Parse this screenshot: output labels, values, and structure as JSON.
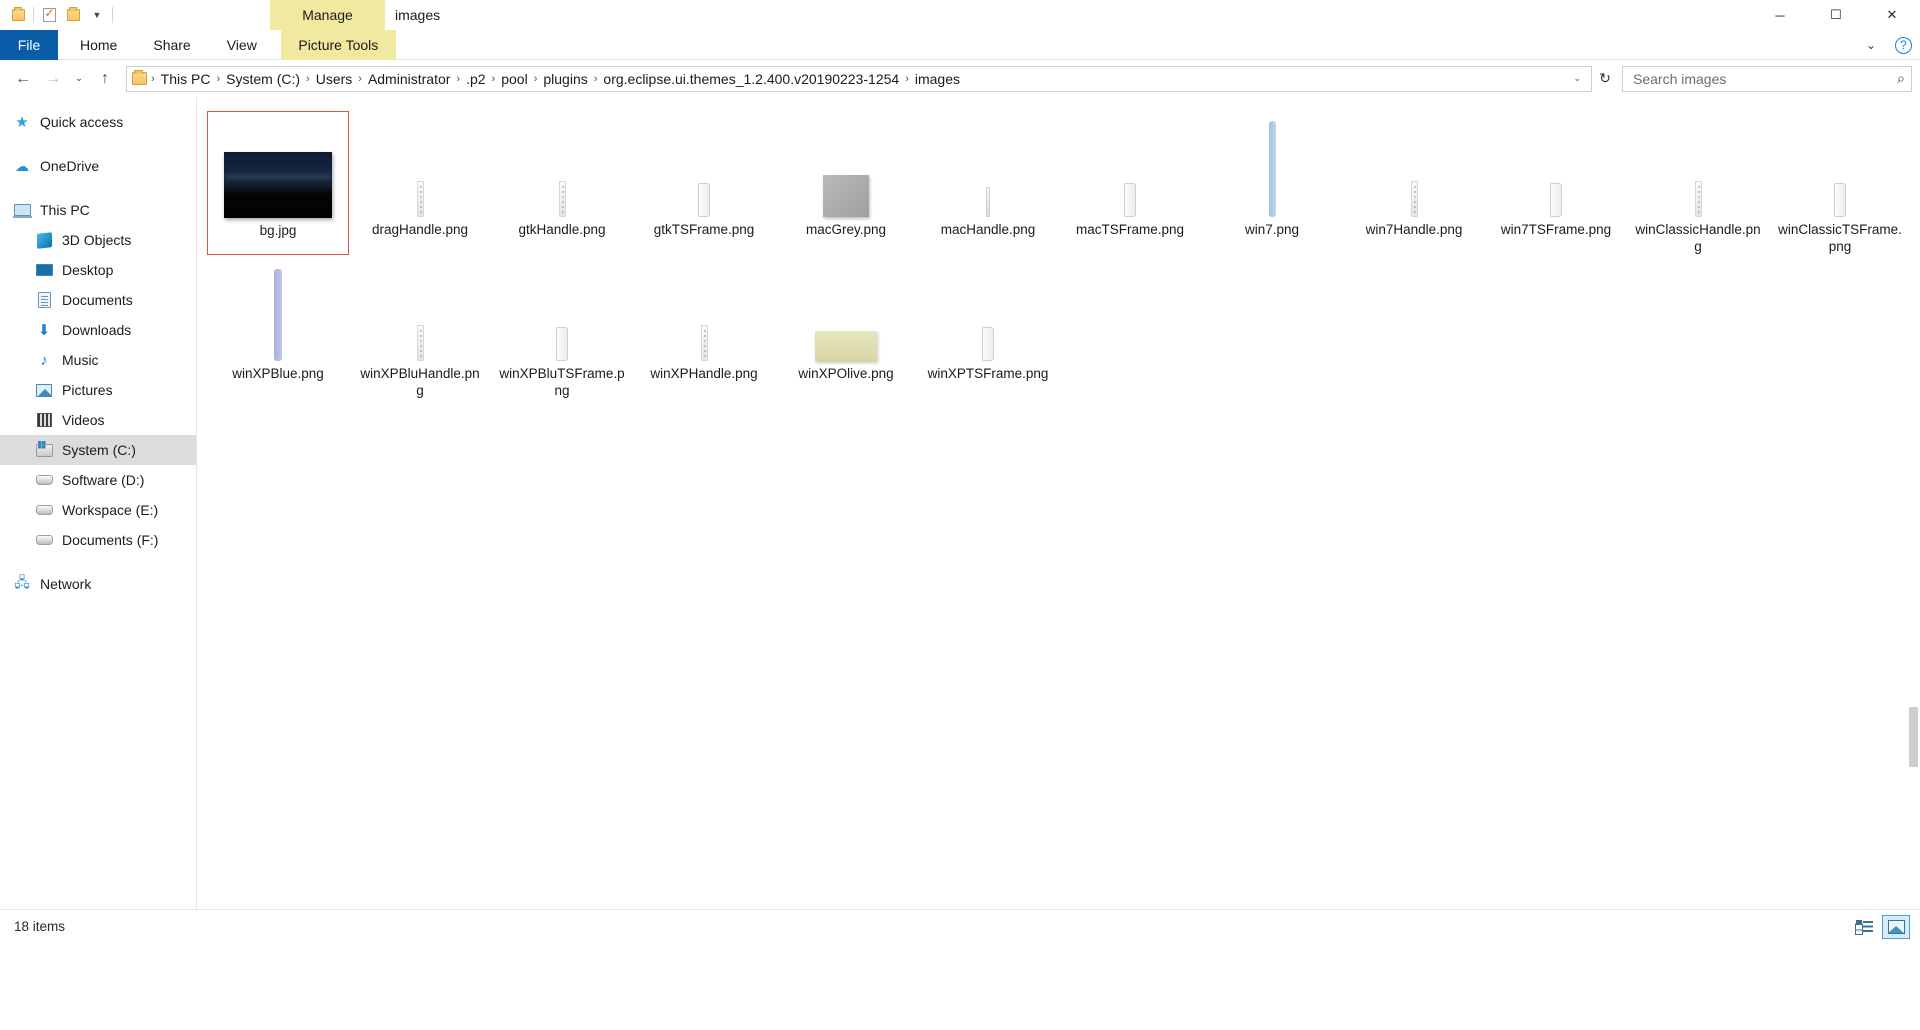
{
  "window": {
    "title": "images",
    "quick_access": [
      {
        "name": "folder-new-icon",
        "label": "New folder"
      },
      {
        "name": "properties-icon",
        "label": "Properties"
      },
      {
        "name": "folder-icon",
        "label": "Folder"
      },
      {
        "name": "customize-qat-icon",
        "label": "Customize Quick Access Toolbar"
      }
    ],
    "contextual_tab": "Manage",
    "controls": {
      "minimize": "─",
      "maximize": "☐",
      "close": "✕"
    }
  },
  "ribbon": {
    "tabs": [
      {
        "label": "File",
        "active": false,
        "kind": "file"
      },
      {
        "label": "Home",
        "active": false,
        "kind": "normal"
      },
      {
        "label": "Share",
        "active": false,
        "kind": "normal"
      },
      {
        "label": "View",
        "active": false,
        "kind": "normal"
      },
      {
        "label": "Picture Tools",
        "active": true,
        "kind": "contextual"
      }
    ],
    "collapse_label": "⌄",
    "help_label": "?"
  },
  "address": {
    "back": "←",
    "forward": "→",
    "recent": "⌄",
    "up": "↑",
    "refresh": "↻",
    "dropdown": "⌄",
    "breadcrumbs": [
      "This PC",
      "System (C:)",
      "Users",
      "Administrator",
      ".p2",
      "pool",
      "plugins",
      "org.eclipse.ui.themes_1.2.400.v20190223-1254",
      "images"
    ],
    "separator": "›"
  },
  "search": {
    "placeholder": "Search images",
    "icon": "search-icon",
    "value": ""
  },
  "sidebar": {
    "items": [
      {
        "label": "Quick access",
        "icon": "star-icon",
        "indent": false,
        "selected": false,
        "gap_after": true
      },
      {
        "label": "OneDrive",
        "icon": "cloud-icon",
        "indent": false,
        "selected": false,
        "gap_after": true
      },
      {
        "label": "This PC",
        "icon": "computer-icon",
        "indent": false,
        "selected": false,
        "gap_after": false
      },
      {
        "label": "3D Objects",
        "icon": "3d-objects-icon",
        "indent": true,
        "selected": false,
        "gap_after": false
      },
      {
        "label": "Desktop",
        "icon": "desktop-icon",
        "indent": true,
        "selected": false,
        "gap_after": false
      },
      {
        "label": "Documents",
        "icon": "documents-icon",
        "indent": true,
        "selected": false,
        "gap_after": false
      },
      {
        "label": "Downloads",
        "icon": "downloads-icon",
        "indent": true,
        "selected": false,
        "gap_after": false
      },
      {
        "label": "Music",
        "icon": "music-icon",
        "indent": true,
        "selected": false,
        "gap_after": false
      },
      {
        "label": "Pictures",
        "icon": "pictures-icon",
        "indent": true,
        "selected": false,
        "gap_after": false
      },
      {
        "label": "Videos",
        "icon": "videos-icon",
        "indent": true,
        "selected": false,
        "gap_after": false
      },
      {
        "label": "System (C:)",
        "icon": "system-drive-icon",
        "indent": true,
        "selected": true,
        "gap_after": false
      },
      {
        "label": "Software (D:)",
        "icon": "drive-icon",
        "indent": true,
        "selected": false,
        "gap_after": false
      },
      {
        "label": "Workspace (E:)",
        "icon": "drive-icon",
        "indent": true,
        "selected": false,
        "gap_after": false
      },
      {
        "label": "Documents (F:)",
        "icon": "drive-icon",
        "indent": true,
        "selected": false,
        "gap_after": true
      },
      {
        "label": "Network",
        "icon": "network-icon",
        "indent": false,
        "selected": false,
        "gap_after": false
      }
    ]
  },
  "files": {
    "items": [
      {
        "label": "bg.jpg",
        "thumb": "photo",
        "selected": true
      },
      {
        "label": "dragHandle.png",
        "thumb": "handle-dots",
        "selected": false
      },
      {
        "label": "gtkHandle.png",
        "thumb": "handle-dots",
        "selected": false
      },
      {
        "label": "gtkTSFrame.png",
        "thumb": "frame",
        "selected": false
      },
      {
        "label": "macGrey.png",
        "thumb": "grey-square",
        "selected": false
      },
      {
        "label": "macHandle.png",
        "thumb": "handle-thin",
        "selected": false
      },
      {
        "label": "macTSFrame.png",
        "thumb": "frame",
        "selected": false
      },
      {
        "label": "win7.png",
        "thumb": "bar-blue",
        "selected": false
      },
      {
        "label": "win7Handle.png",
        "thumb": "handle-dots",
        "selected": false
      },
      {
        "label": "win7TSFrame.png",
        "thumb": "frame",
        "selected": false
      },
      {
        "label": "winClassicHandle.png",
        "thumb": "handle-dots",
        "selected": false
      },
      {
        "label": "winClassicTSFrame.png",
        "thumb": "frame",
        "selected": false
      },
      {
        "label": "winXPBlue.png",
        "thumb": "bar-purple",
        "selected": false
      },
      {
        "label": "winXPBluHandle.png",
        "thumb": "handle-dots",
        "selected": false
      },
      {
        "label": "winXPBluTSFrame.png",
        "thumb": "frame",
        "selected": false
      },
      {
        "label": "winXPHandle.png",
        "thumb": "handle-dots",
        "selected": false
      },
      {
        "label": "winXPOlive.png",
        "thumb": "olive-rect",
        "selected": false
      },
      {
        "label": "winXPTSFrame.png",
        "thumb": "frame",
        "selected": false
      }
    ]
  },
  "status": {
    "item_count": "18 items",
    "views": [
      {
        "name": "details-view-button",
        "active": false
      },
      {
        "name": "large-icons-view-button",
        "active": true
      }
    ]
  },
  "colors": {
    "file_tab": "#0b5ca8",
    "contextual_tab": "#f2e9a0",
    "selection_border": "#d9534f",
    "sidebar_selected": "#dcdcdc",
    "accent": "#1e7fd4"
  }
}
